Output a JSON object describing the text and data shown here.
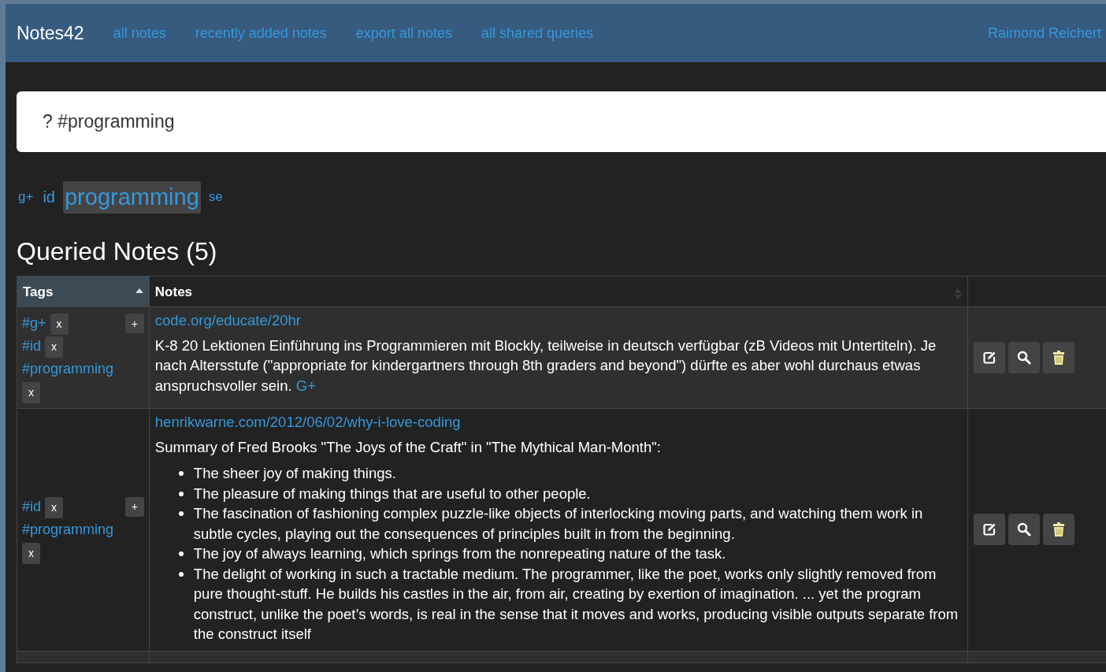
{
  "navbar": {
    "brand": "Notes42",
    "links": [
      "all notes",
      "recently added notes",
      "export all notes",
      "all shared queries"
    ],
    "user": "Raimond Reichert"
  },
  "search": {
    "value": "? #programming"
  },
  "tag_cloud": [
    {
      "label": "g+",
      "kind": "small",
      "selected": false
    },
    {
      "label": "id",
      "kind": "medium",
      "selected": false
    },
    {
      "label": "programming",
      "kind": "large",
      "selected": true
    },
    {
      "label": "se",
      "kind": "small",
      "selected": false
    }
  ],
  "heading": "Queried Notes (5)",
  "table": {
    "columns": [
      {
        "label": "Tags",
        "sorted": true
      },
      {
        "label": "Notes",
        "sorted": false
      }
    ],
    "rows": [
      {
        "tags": [
          {
            "label": "#g+",
            "remove": "x"
          },
          {
            "label": "#id",
            "remove": "x"
          },
          {
            "label": "#programming",
            "remove": "x"
          }
        ],
        "add": "+",
        "link": "code.org/educate/20hr",
        "paragraphs": [
          {
            "text": "K-8 20 Lektionen Einführung ins Programmieren mit Blockly, teilweise in deutsch verfügbar (zB Videos mit Untertiteln). Je nach Altersstufe (\"appropriate for kindergartners through 8th graders and beyond\") dürfte es aber wohl durchaus etwas anspruchsvoller sein.",
            "link": "G+"
          }
        ],
        "bullets": []
      },
      {
        "tags": [
          {
            "label": "#id",
            "remove": "x"
          },
          {
            "label": "#programming",
            "remove": "x"
          }
        ],
        "add": "+",
        "link": "henrikwarne.com/2012/06/02/why-i-love-coding",
        "paragraphs": [
          {
            "text": "Summary of Fred Brooks \"The Joys of the Craft\" in \"The Mythical Man-Month\":"
          }
        ],
        "bullets": [
          "The sheer joy of making things.",
          "The pleasure of making things that are useful to other people.",
          "The fascination of fashioning complex puzzle-like objects of interlocking moving parts, and watching them work in subtle cycles, playing out the consequences of principles built in from the beginning.",
          "The joy of always learning, which springs from the nonrepeating nature of the task.",
          "The delight of working in such a tractable medium. The programmer, like the poet, works only slightly removed from pure thought-stuff. He builds his castles in the air, from air, creating by exertion of imagination. ... yet the program construct, unlike the poet’s words, is real in the sense that it moves and works, producing visible outputs separate from the construct itself"
        ]
      }
    ]
  }
}
